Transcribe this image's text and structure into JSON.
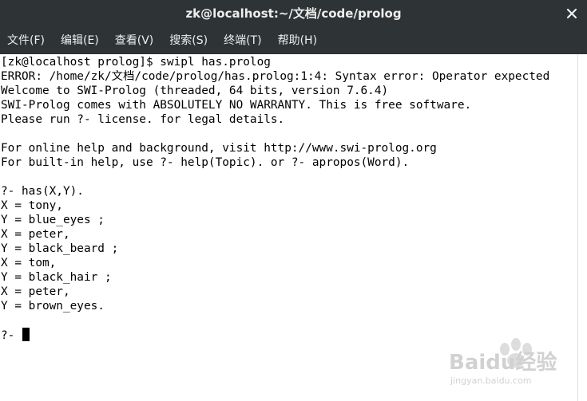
{
  "window": {
    "title": "zk@localhost:~/文档/code/prolog"
  },
  "menu": [
    {
      "label": "文件(F)"
    },
    {
      "label": "编辑(E)"
    },
    {
      "label": "查看(V)"
    },
    {
      "label": "搜索(S)"
    },
    {
      "label": "终端(T)"
    },
    {
      "label": "帮助(H)"
    }
  ],
  "terminal": {
    "lines": [
      "[zk@localhost prolog]$ swipl has.prolog",
      "ERROR: /home/zk/文档/code/prolog/has.prolog:1:4: Syntax error: Operator expected",
      "Welcome to SWI-Prolog (threaded, 64 bits, version 7.6.4)",
      "SWI-Prolog comes with ABSOLUTELY NO WARRANTY. This is free software.",
      "Please run ?- license. for legal details.",
      "",
      "For online help and background, visit http://www.swi-prolog.org",
      "For built-in help, use ?- help(Topic). or ?- apropos(Word).",
      "",
      "?- has(X,Y).",
      "X = tony,",
      "Y = blue_eyes ;",
      "X = peter,",
      "Y = black_beard ;",
      "X = tom,",
      "Y = black_hair ;",
      "X = peter,",
      "Y = brown_eyes.",
      "",
      "?- "
    ]
  },
  "colors": {
    "titlebar_bg": "#2e3436",
    "titlebar_fg": "#eeeeec",
    "terminal_bg": "#ffffff",
    "terminal_fg": "#000000"
  },
  "icons": {
    "close": "close-icon"
  },
  "watermark": {
    "brand": "Baidu经验",
    "sub": "jingyan.baidu.com"
  }
}
